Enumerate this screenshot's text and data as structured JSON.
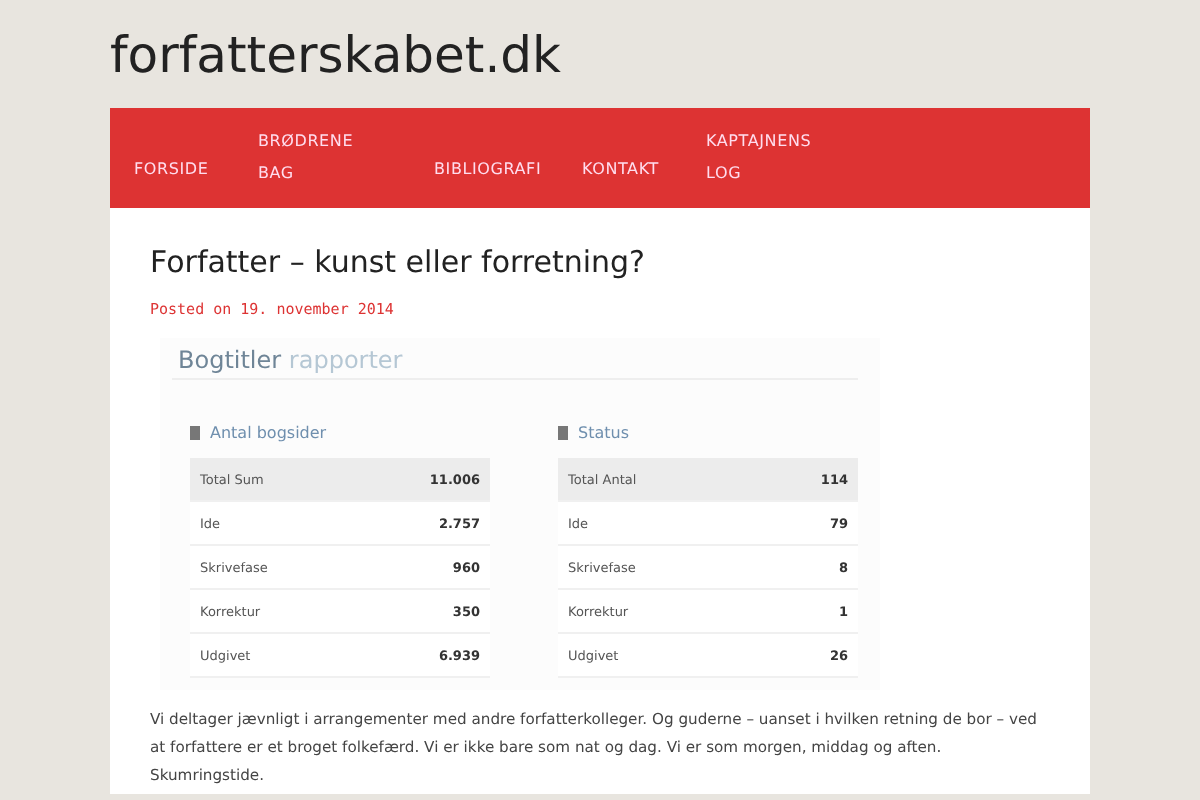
{
  "site_title": "forfatterskabet.dk",
  "nav": [
    {
      "label": "FORSIDE"
    },
    {
      "label": "BRØDRENE BAG"
    },
    {
      "label": "BIBLIOGRAFI"
    },
    {
      "label": "KONTAKT"
    },
    {
      "label": "KAPTAJNENS LOG"
    }
  ],
  "post": {
    "title": "Forfatter – kunst eller forretning?",
    "meta": "Posted on 19. november 2014",
    "report": {
      "heading": "Bogtitler",
      "heading_light": "rapporter",
      "tables": [
        {
          "title": "Antal bogsider",
          "rows": [
            {
              "label": "Total Sum",
              "value": "11.006",
              "total": true
            },
            {
              "label": "Ide",
              "value": "2.757",
              "total": false
            },
            {
              "label": "Skrivefase",
              "value": "960",
              "total": false
            },
            {
              "label": "Korrektur",
              "value": "350",
              "total": false
            },
            {
              "label": "Udgivet",
              "value": "6.939",
              "total": false
            }
          ]
        },
        {
          "title": "Status",
          "rows": [
            {
              "label": "Total Antal",
              "value": "114",
              "total": true
            },
            {
              "label": "Ide",
              "value": "79",
              "total": false
            },
            {
              "label": "Skrivefase",
              "value": "8",
              "total": false
            },
            {
              "label": "Korrektur",
              "value": "1",
              "total": false
            },
            {
              "label": "Udgivet",
              "value": "26",
              "total": false
            }
          ]
        }
      ]
    },
    "paragraph": "Vi deltager jævnligt i arrangementer med andre forfatterkolleger. Og guderne – uanset i hvilken retning de bor – ved at forfattere er et broget folkefærd. Vi er ikke bare som nat og dag. Vi er som morgen, middag og aften. Skumringstide."
  }
}
